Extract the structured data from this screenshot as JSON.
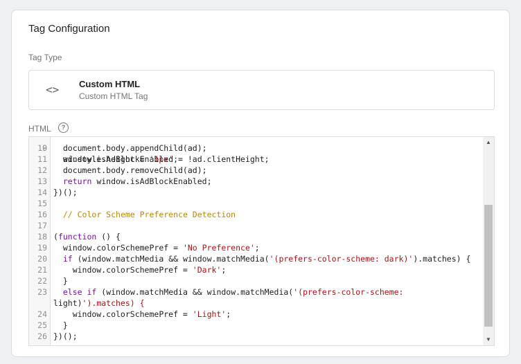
{
  "card": {
    "title": "Tag Configuration",
    "tag_type_label": "Tag Type",
    "tag_type": {
      "icon": "code-brackets-icon",
      "name": "Custom HTML",
      "subtitle": "Custom HTML Tag"
    },
    "html_label": "HTML",
    "help_icon": "question-circle-icon"
  },
  "editor": {
    "first_partial_text": "  ad.style.height = '1px';",
    "lines": [
      {
        "num": "10",
        "text": "  document.body.appendChild(ad);"
      },
      {
        "num": "11",
        "text": "  window.isAdBlockEnabled = !ad.clientHeight;"
      },
      {
        "num": "12",
        "text": "  document.body.removeChild(ad);"
      },
      {
        "num": "13",
        "text": "  return window.isAdBlockEnabled;"
      },
      {
        "num": "14",
        "text": "})();"
      },
      {
        "num": "15",
        "text": ""
      },
      {
        "num": "16",
        "text": "  // Color Scheme Preference Detection"
      },
      {
        "num": "17",
        "text": ""
      },
      {
        "num": "18",
        "text": "(function () {"
      },
      {
        "num": "19",
        "text": "  window.colorSchemePref = 'No Preference';"
      },
      {
        "num": "20",
        "text": "  if (window.matchMedia && window.matchMedia('(prefers-color-scheme: dark)').matches) {"
      },
      {
        "num": "21",
        "text": "    window.colorSchemePref = 'Dark';"
      },
      {
        "num": "22",
        "text": "  }"
      },
      {
        "num": "23",
        "text": "  else if (window.matchMedia && window.matchMedia('(prefers-color-scheme:"
      },
      {
        "num": "",
        "text": "light)').matches) {"
      },
      {
        "num": "24",
        "text": "    window.colorSchemePref = 'Light';"
      },
      {
        "num": "25",
        "text": "  }"
      },
      {
        "num": "26",
        "text": "})();"
      }
    ]
  },
  "colors": {
    "keyword": "#7a0f9e",
    "string": "#a31515",
    "comment": "#b8860b"
  }
}
